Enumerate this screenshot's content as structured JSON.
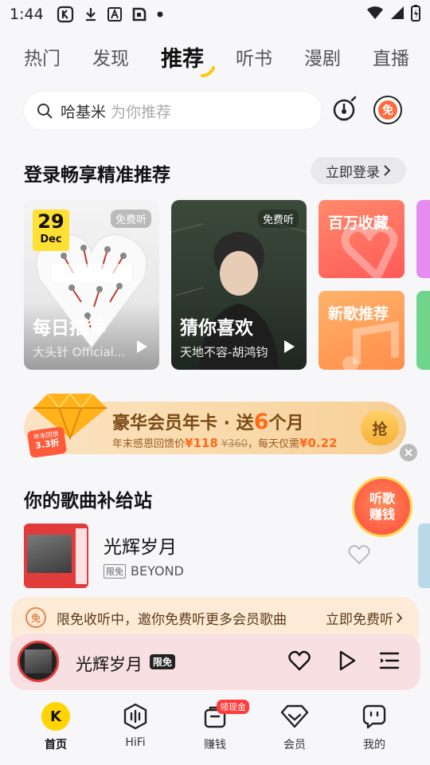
{
  "status": {
    "time": "1:44"
  },
  "tabs": [
    {
      "label": "热门"
    },
    {
      "label": "发现"
    },
    {
      "label": "推荐"
    },
    {
      "label": "听书"
    },
    {
      "label": "漫剧"
    },
    {
      "label": "直播"
    }
  ],
  "search": {
    "value": "哈基米",
    "hint": "为你推荐"
  },
  "free_button": {
    "label": "免"
  },
  "login_section": {
    "title": "登录畅享精准推荐",
    "login_button": "立即登录"
  },
  "cards": {
    "daily": {
      "title": "每日推荐",
      "subtitle": "大头针 Official...",
      "badge": "免费听",
      "date_day": "29",
      "date_month": "Dec"
    },
    "guess": {
      "title": "猜你喜欢",
      "subtitle": "天地不容-胡鸿钧",
      "badge": "免费听"
    }
  },
  "tiles": [
    {
      "label": "百万收藏"
    },
    {
      "label": "新歌推荐"
    }
  ],
  "vip_banner": {
    "title_prefix": "豪华会员年卡 · 送",
    "title_number": "6",
    "title_suffix": "个月",
    "sub_prefix": "年末感恩回馈价",
    "price": "¥118",
    "orig_price": "¥360",
    "sub_suffix": "，每天仅需",
    "daily_price": "¥0.22",
    "corner_line1": "年末回馈",
    "corner_line2": "3.3折",
    "button": "抢"
  },
  "earn_float": {
    "line1": "听歌",
    "line2": "赚钱"
  },
  "songs_section": {
    "title": "你的歌曲补给站"
  },
  "song": {
    "name": "光辉岁月",
    "tag": "限免",
    "artist": "BEYOND"
  },
  "promo": {
    "icon": "免",
    "text": "限免收听中，邀你免费听更多会员歌曲",
    "cta": "立即免费听"
  },
  "player": {
    "title": "光辉岁月",
    "tag": "限免"
  },
  "bottom_nav": [
    {
      "label": "首页",
      "active": true
    },
    {
      "label": "HiFi"
    },
    {
      "label": "赚钱",
      "badge": "领现金"
    },
    {
      "label": "会员"
    },
    {
      "label": "我的"
    }
  ],
  "colors": {
    "accent": "#ffd400",
    "brand_orange": "#ff6a3d",
    "player_bg": "#f8dfe1"
  }
}
